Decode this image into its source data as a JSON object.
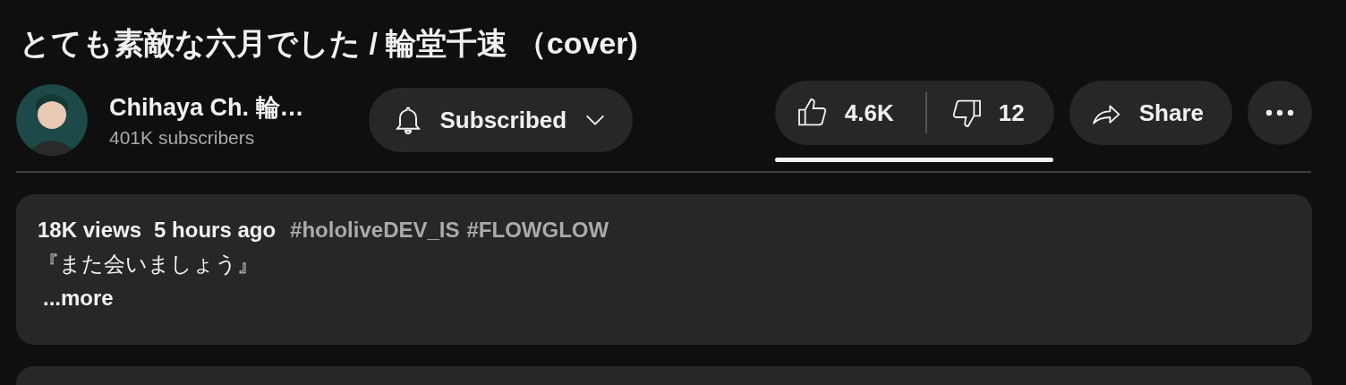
{
  "video": {
    "title": "とても素敵な六月でした / 輪堂千速 （cover)"
  },
  "channel": {
    "name": "Chihaya Ch. 輪…",
    "subscribers": "401K subscribers",
    "subscribe_button": {
      "label": "Subscribed",
      "subscribed": true
    }
  },
  "actions": {
    "likes": "4.6K",
    "dislikes": "12",
    "liked": false,
    "disliked": false,
    "like_ratio": {
      "level": 0.997
    },
    "share": "Share"
  },
  "description": {
    "views": "18K views",
    "time": "5 hours ago",
    "hashtags": [
      "#hololiveDEV_IS",
      "#FLOWGLOW"
    ],
    "text": "『また会いましょう』",
    "more": "...more"
  }
}
